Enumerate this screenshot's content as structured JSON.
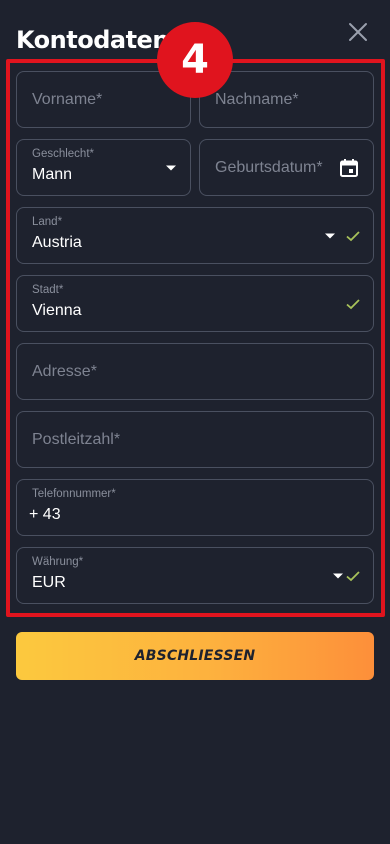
{
  "header": {
    "title": "Kontodaten",
    "step_number": "4",
    "close_icon": "close-icon"
  },
  "form": {
    "vorname": {
      "placeholder": "Vorname*"
    },
    "nachname": {
      "placeholder": "Nachname*"
    },
    "geschlecht": {
      "label": "Geschlecht*",
      "value": "Mann"
    },
    "geburtsdatum": {
      "placeholder": "Geburtsdatum*",
      "icon": "calendar-icon"
    },
    "land": {
      "label": "Land*",
      "value": "Austria",
      "valid": true
    },
    "stadt": {
      "label": "Stadt*",
      "value": "Vienna",
      "valid": true
    },
    "adresse": {
      "placeholder": "Adresse*"
    },
    "postleitzahl": {
      "placeholder": "Postleitzahl*"
    },
    "telefon": {
      "label": "Telefonnummer*",
      "value": "+ 43"
    },
    "waehrung": {
      "label": "Währung*",
      "value": "EUR",
      "valid": true
    }
  },
  "actions": {
    "submit_label": "ABSCHLIESSEN"
  },
  "colors": {
    "background": "#1e222e",
    "field_border": "#4a5060",
    "highlight": "#e0141e",
    "check": "#a8c25a",
    "button_start": "#fcc93e",
    "button_end": "#fd8f3a"
  }
}
